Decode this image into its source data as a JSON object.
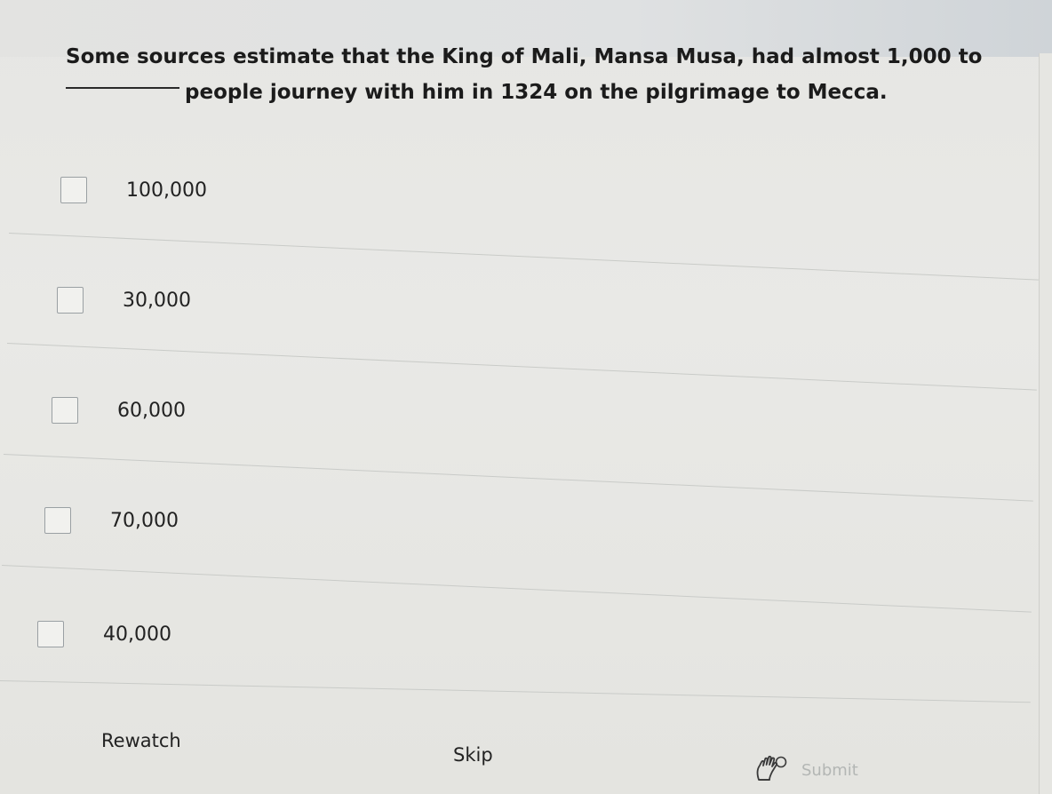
{
  "question": {
    "line1": "Some sources estimate that the King of Mali, Mansa Musa, had almost 1,000 to",
    "line2": "people journey with him in 1324 on the pilgrimage to Mecca."
  },
  "options": [
    {
      "label": "100,000",
      "checked": false
    },
    {
      "label": "30,000",
      "checked": false
    },
    {
      "label": "60,000",
      "checked": false
    },
    {
      "label": "70,000",
      "checked": false
    },
    {
      "label": "40,000",
      "checked": false
    }
  ],
  "footer": {
    "rewatch_label": "Rewatch",
    "skip_label": "Skip",
    "submit_label": "Submit",
    "submit_icon": "raised-hand-icon"
  },
  "colors": {
    "background": "#e7e7e4",
    "text": "#1e1e1e",
    "checkbox_border": "#9aa0a3",
    "divider": "#c9cbc8",
    "submit_disabled": "#b3b6b4"
  }
}
